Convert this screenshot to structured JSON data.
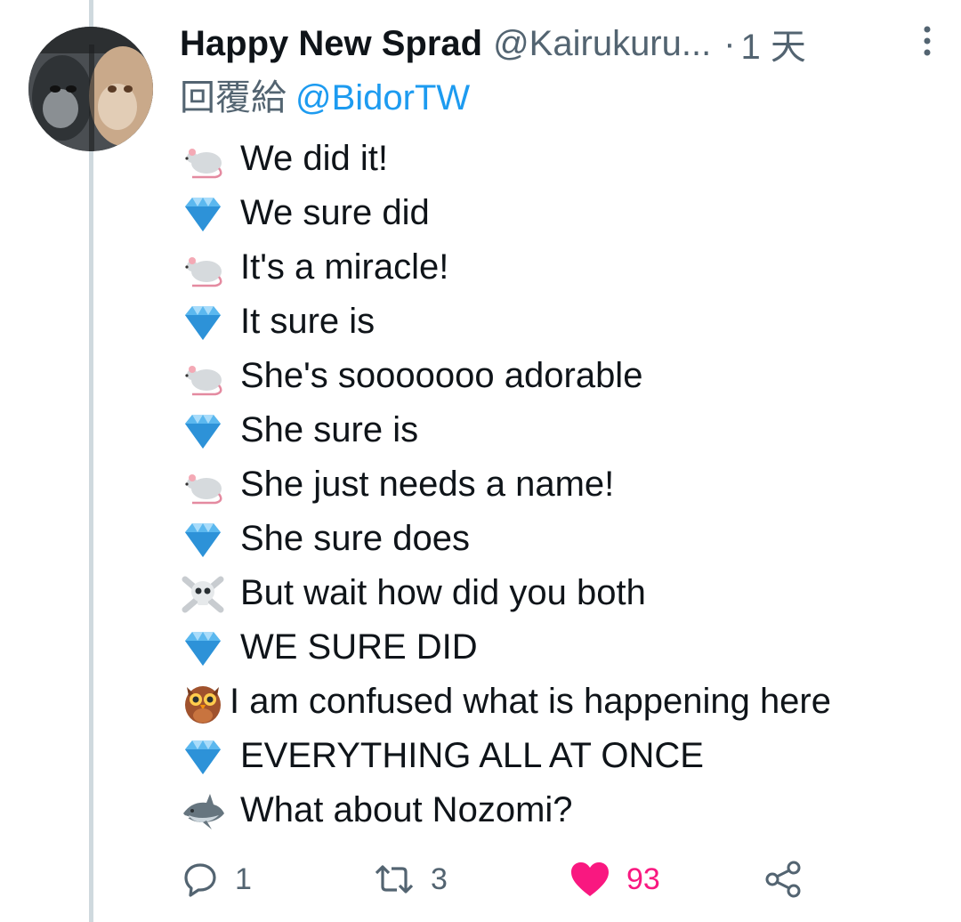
{
  "tweet": {
    "author_name": "Happy New Sprad",
    "author_handle": "@Kairukuru...",
    "dot": "·",
    "time": "1 天",
    "reply_prefix": "回覆給",
    "reply_to": "@BidorTW",
    "lines": [
      {
        "emoji": "mouse-icon",
        "text": "We did it!"
      },
      {
        "emoji": "gem-icon",
        "text": "We sure did"
      },
      {
        "emoji": "mouse-icon",
        "text": "It's a miracle!"
      },
      {
        "emoji": "gem-icon",
        "text": "It sure is"
      },
      {
        "emoji": "mouse-icon",
        "text": "She's sooooooo adorable"
      },
      {
        "emoji": "gem-icon",
        "text": "She sure is"
      },
      {
        "emoji": "mouse-icon",
        "text": "She just needs a name!"
      },
      {
        "emoji": "gem-icon",
        "text": "She sure does"
      },
      {
        "emoji": "skull-crossbones-icon",
        "text": "But wait how did you both"
      },
      {
        "emoji": "gem-icon",
        "text": "WE SURE DID"
      },
      {
        "emoji": "owl-icon",
        "text": "I am confused what is happening here"
      },
      {
        "emoji": "gem-icon",
        "text": "EVERYTHING ALL AT ONCE"
      },
      {
        "emoji": "shark-icon",
        "text": "What about Nozomi?"
      }
    ],
    "actions": {
      "reply_count": "1",
      "retweet_count": "3",
      "like_count": "93"
    }
  },
  "colors": {
    "accent": "#1d9bf0",
    "like": "#f91880",
    "secondary_text": "#536471",
    "thread_line": "#cfd9de"
  }
}
